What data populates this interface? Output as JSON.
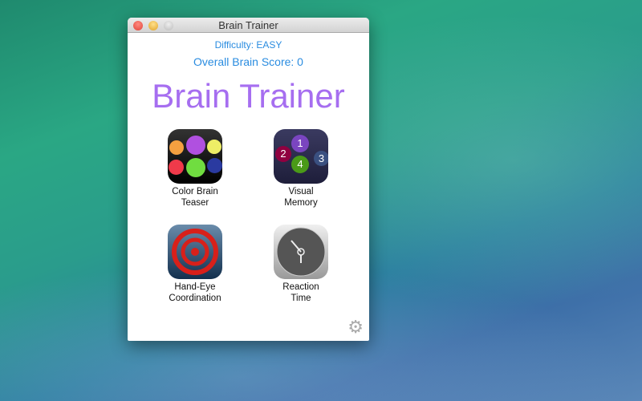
{
  "window": {
    "title": "Brain Trainer"
  },
  "header": {
    "difficulty": "Difficulty: EASY",
    "score": "Overall Brain Score: 0",
    "title": "Brain Trainer"
  },
  "games": [
    {
      "label1": "Color Brain",
      "label2": "Teaser"
    },
    {
      "label1": "Visual",
      "label2": "Memory",
      "numbers": [
        "1",
        "2",
        "3",
        "4"
      ]
    },
    {
      "label1": "Hand-Eye",
      "label2": "Coordination"
    },
    {
      "label1": "Reaction",
      "label2": "Time"
    }
  ]
}
